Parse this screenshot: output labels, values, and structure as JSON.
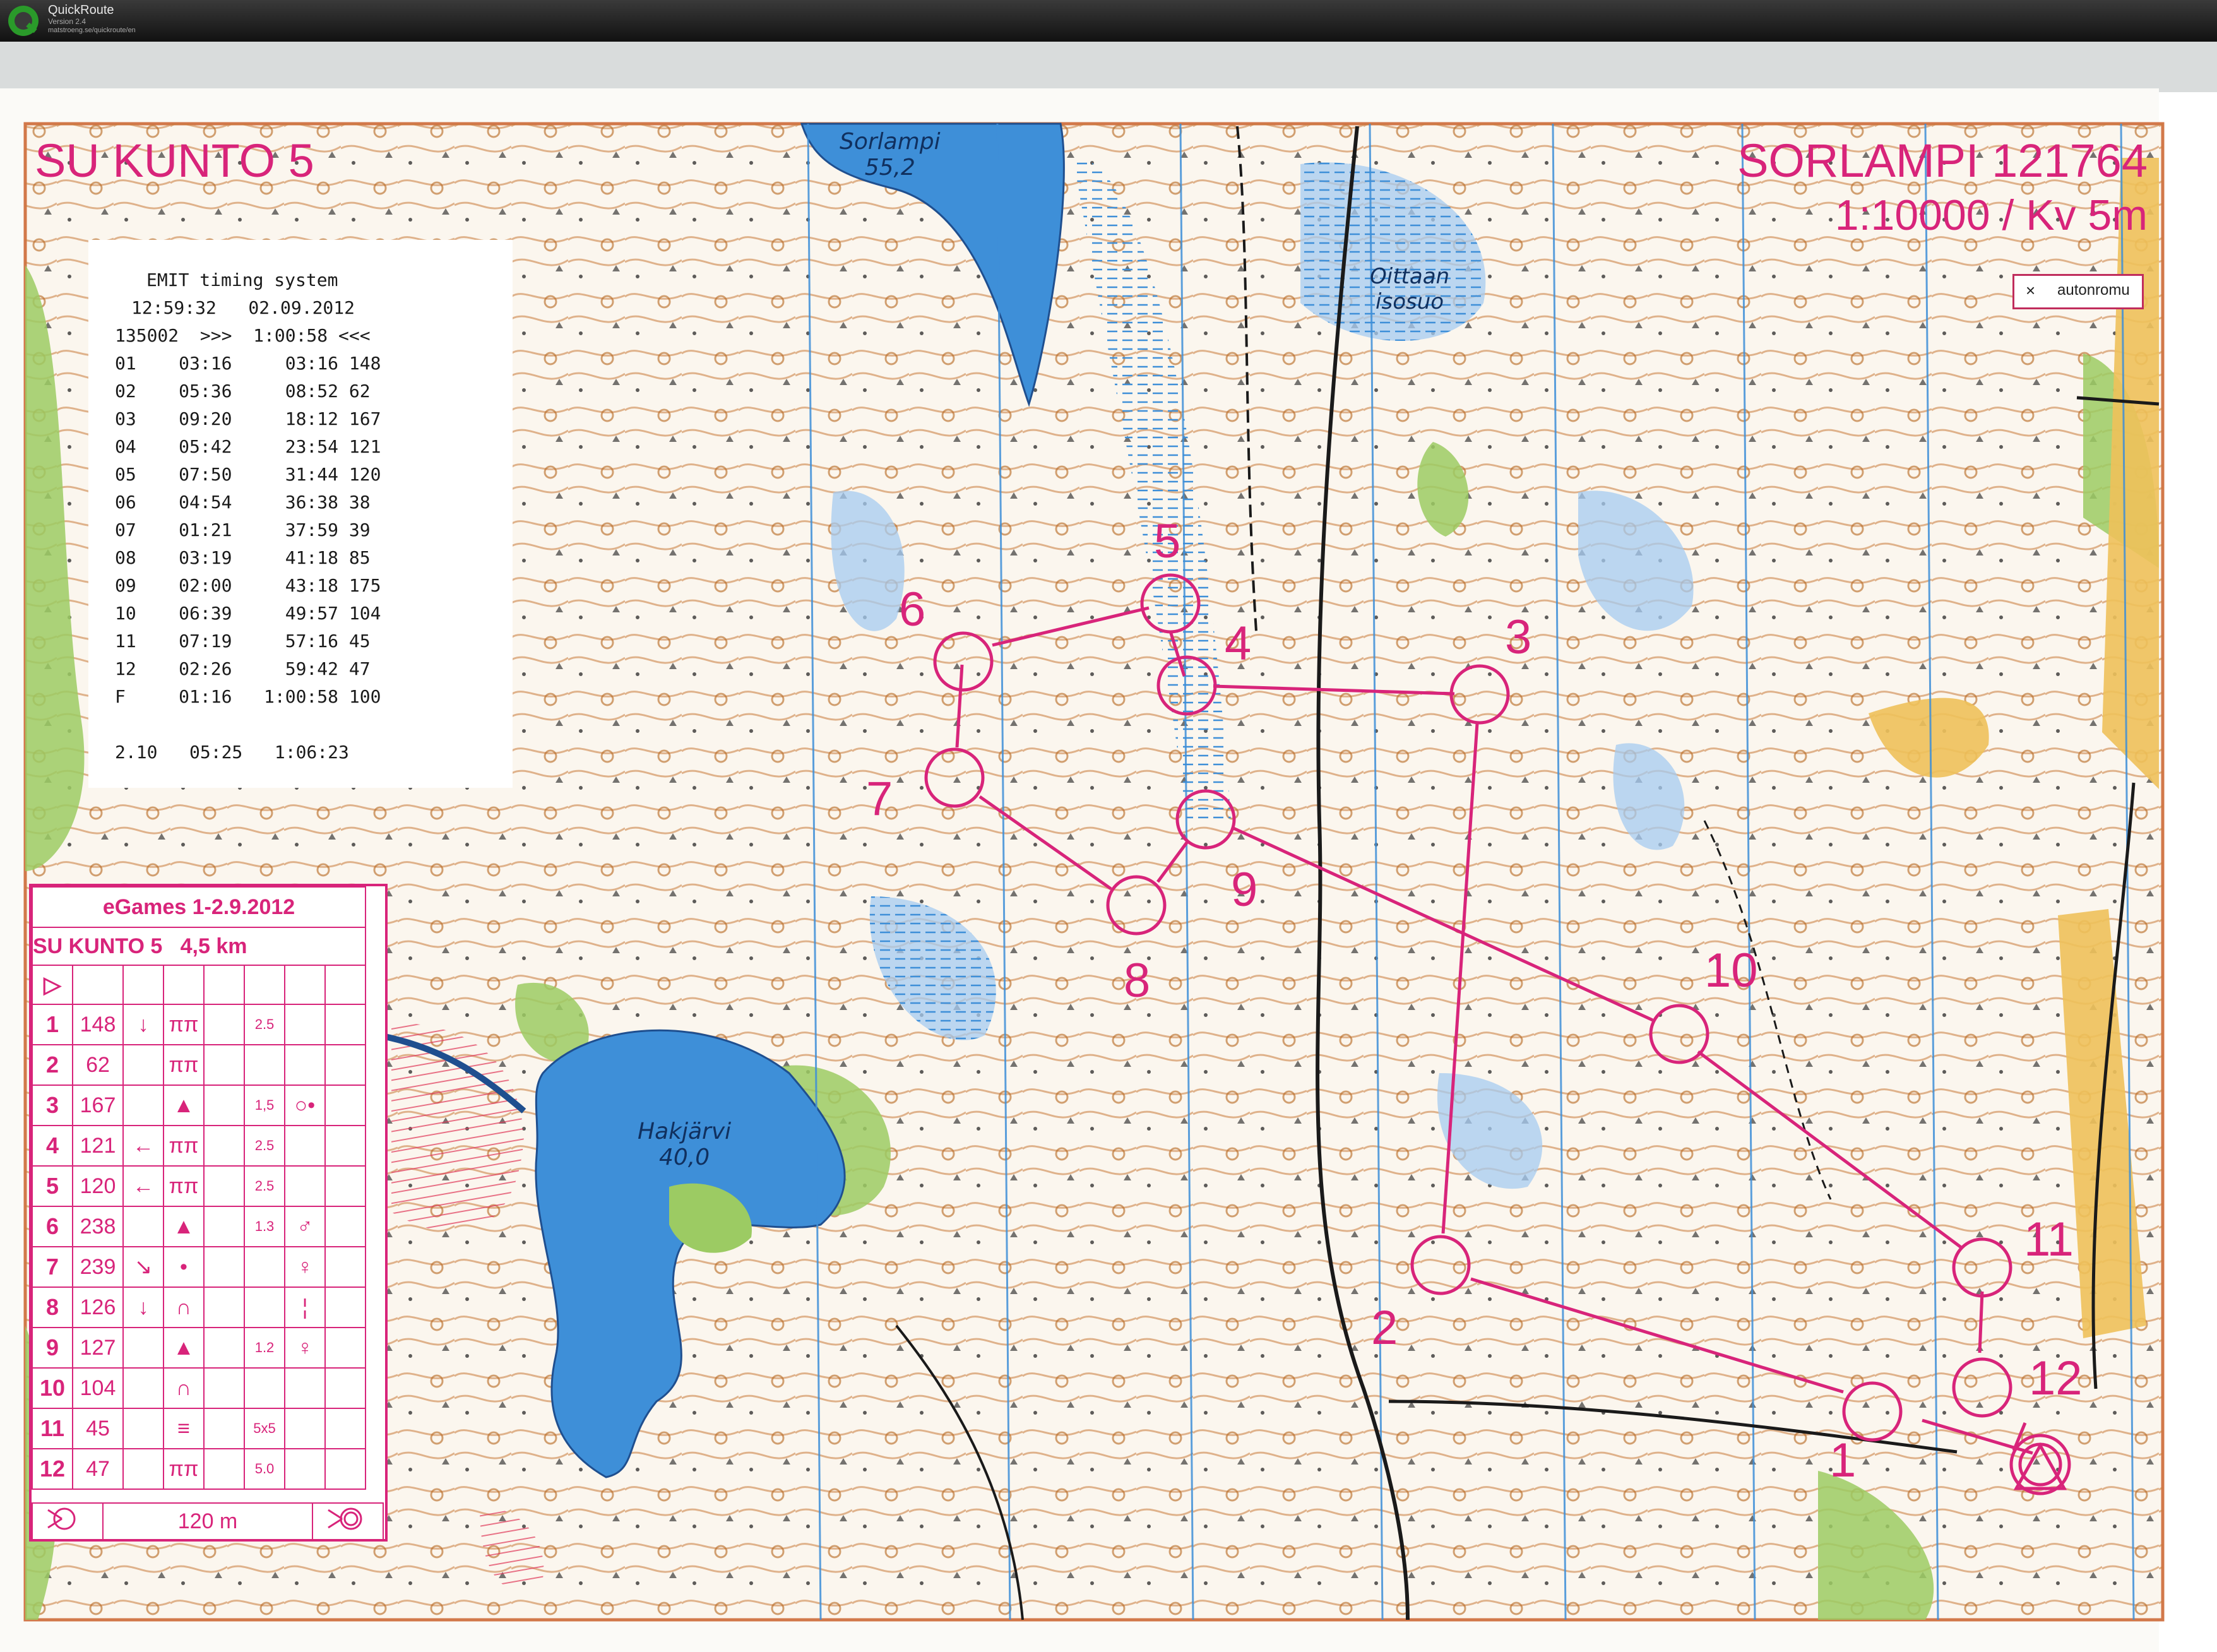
{
  "window": {
    "app_name": "QuickRoute",
    "version": "Version 2.4",
    "url": "matstroeng.se/quickroute/en"
  },
  "map": {
    "title_left": "SU KUNTO 5",
    "title_right": "SORLAMPI 121764",
    "scale": "1:10000 / Kv 5m",
    "legend_symbol": "×",
    "legend_label": "autonromu",
    "lakes": [
      {
        "name": "Sorlampi",
        "elevation": "55,2"
      },
      {
        "name": "Oittaan",
        "sub": "isosuo"
      },
      {
        "name": "Hakjärvi",
        "elevation": "40,0"
      }
    ],
    "control_labels": [
      "1",
      "2",
      "3",
      "4",
      "5",
      "6",
      "7",
      "8",
      "9",
      "10",
      "11",
      "12"
    ],
    "colors": {
      "course": "#d8247a",
      "water": "#3e8fd8",
      "marsh": "#9dc4ee",
      "forest_green": "#8fc45a",
      "open_yellow": "#e6b640",
      "contour": "#b5651d",
      "rock": "#1a1a1a"
    }
  },
  "timing": {
    "header": "EMIT timing system",
    "timestamp": "12:59:32   02.09.2012",
    "summary": "135002  >>>  1:00:58 <<<",
    "rows": [
      "01    03:16     03:16 148",
      "02    05:36     08:52 62",
      "03    09:20     18:12 167",
      "04    05:42     23:54 121",
      "05    07:50     31:44 120",
      "06    04:54     36:38 38",
      "07    01:21     37:59 39",
      "08    03:19     41:18 85",
      "09    02:00     43:18 175",
      "10    06:39     49:57 104",
      "11    07:19     57:16 45",
      "12    02:26     59:42 47",
      "F     01:16   1:00:58 100"
    ],
    "footer": "2.10   05:25   1:06:23"
  },
  "description": {
    "title": "eGames 1-2.9.2012",
    "course": "SU KUNTO 5",
    "length": "4,5 km",
    "start_symbol": "▷",
    "controls": [
      {
        "num": "1",
        "code": "148",
        "dir": "↓",
        "feature": "ππ",
        "size": "2.5",
        "detail": ""
      },
      {
        "num": "2",
        "code": "62",
        "dir": "",
        "feature": "ππ",
        "size": "",
        "detail": ""
      },
      {
        "num": "3",
        "code": "167",
        "dir": "",
        "feature": "▲",
        "size": "1,5",
        "detail": "○•"
      },
      {
        "num": "4",
        "code": "121",
        "dir": "←",
        "feature": "ππ",
        "size": "2.5",
        "detail": ""
      },
      {
        "num": "5",
        "code": "120",
        "dir": "←",
        "feature": "ππ",
        "size": "2.5",
        "detail": ""
      },
      {
        "num": "6",
        "code": "238",
        "dir": "",
        "feature": "▲",
        "size": "1.3",
        "detail": "♂"
      },
      {
        "num": "7",
        "code": "239",
        "dir": "↘",
        "feature": "•",
        "size": "",
        "detail": "♀"
      },
      {
        "num": "8",
        "code": "126",
        "dir": "↓",
        "feature": "∩",
        "size": "",
        "detail": "¦"
      },
      {
        "num": "9",
        "code": "127",
        "dir": "",
        "feature": "▲",
        "size": "1.2",
        "detail": "♀"
      },
      {
        "num": "10",
        "code": "104",
        "dir": "",
        "feature": "∩",
        "size": "",
        "detail": ""
      },
      {
        "num": "11",
        "code": "45",
        "dir": "",
        "feature": "≡",
        "size": "5x5",
        "detail": ""
      },
      {
        "num": "12",
        "code": "47",
        "dir": "",
        "feature": "ππ",
        "size": "5.0",
        "detail": ""
      }
    ],
    "finish_distance": "120 m"
  }
}
